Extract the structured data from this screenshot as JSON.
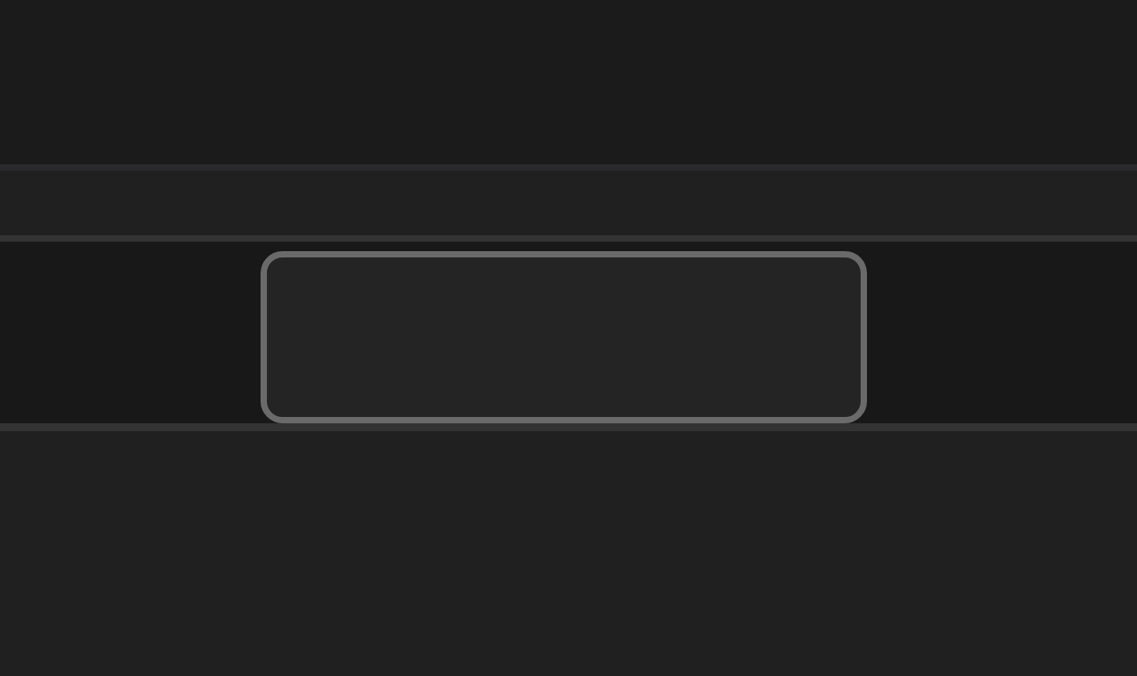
{
  "input_area": {
    "focused": true
  }
}
